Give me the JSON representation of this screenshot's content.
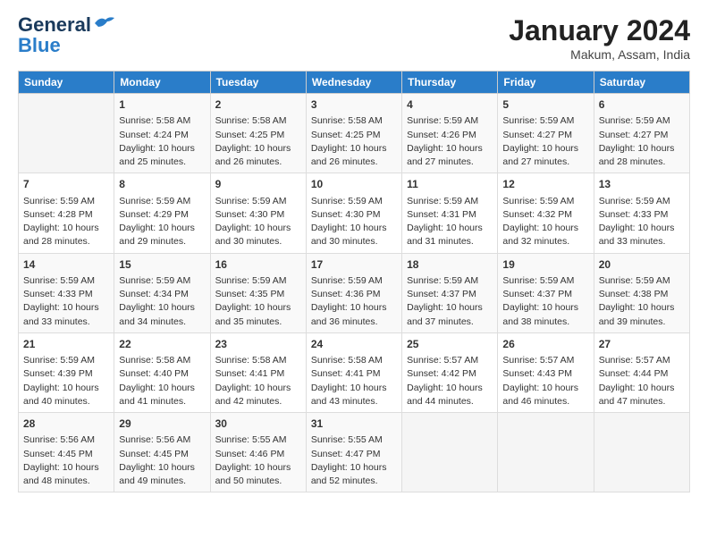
{
  "logo": {
    "line1": "General",
    "line2": "Blue"
  },
  "title": "January 2024",
  "location": "Makum, Assam, India",
  "headers": [
    "Sunday",
    "Monday",
    "Tuesday",
    "Wednesday",
    "Thursday",
    "Friday",
    "Saturday"
  ],
  "rows": [
    [
      {
        "day": "",
        "lines": []
      },
      {
        "day": "1",
        "lines": [
          "Sunrise: 5:58 AM",
          "Sunset: 4:24 PM",
          "Daylight: 10 hours",
          "and 25 minutes."
        ]
      },
      {
        "day": "2",
        "lines": [
          "Sunrise: 5:58 AM",
          "Sunset: 4:25 PM",
          "Daylight: 10 hours",
          "and 26 minutes."
        ]
      },
      {
        "day": "3",
        "lines": [
          "Sunrise: 5:58 AM",
          "Sunset: 4:25 PM",
          "Daylight: 10 hours",
          "and 26 minutes."
        ]
      },
      {
        "day": "4",
        "lines": [
          "Sunrise: 5:59 AM",
          "Sunset: 4:26 PM",
          "Daylight: 10 hours",
          "and 27 minutes."
        ]
      },
      {
        "day": "5",
        "lines": [
          "Sunrise: 5:59 AM",
          "Sunset: 4:27 PM",
          "Daylight: 10 hours",
          "and 27 minutes."
        ]
      },
      {
        "day": "6",
        "lines": [
          "Sunrise: 5:59 AM",
          "Sunset: 4:27 PM",
          "Daylight: 10 hours",
          "and 28 minutes."
        ]
      }
    ],
    [
      {
        "day": "7",
        "lines": [
          "Sunrise: 5:59 AM",
          "Sunset: 4:28 PM",
          "Daylight: 10 hours",
          "and 28 minutes."
        ]
      },
      {
        "day": "8",
        "lines": [
          "Sunrise: 5:59 AM",
          "Sunset: 4:29 PM",
          "Daylight: 10 hours",
          "and 29 minutes."
        ]
      },
      {
        "day": "9",
        "lines": [
          "Sunrise: 5:59 AM",
          "Sunset: 4:30 PM",
          "Daylight: 10 hours",
          "and 30 minutes."
        ]
      },
      {
        "day": "10",
        "lines": [
          "Sunrise: 5:59 AM",
          "Sunset: 4:30 PM",
          "Daylight: 10 hours",
          "and 30 minutes."
        ]
      },
      {
        "day": "11",
        "lines": [
          "Sunrise: 5:59 AM",
          "Sunset: 4:31 PM",
          "Daylight: 10 hours",
          "and 31 minutes."
        ]
      },
      {
        "day": "12",
        "lines": [
          "Sunrise: 5:59 AM",
          "Sunset: 4:32 PM",
          "Daylight: 10 hours",
          "and 32 minutes."
        ]
      },
      {
        "day": "13",
        "lines": [
          "Sunrise: 5:59 AM",
          "Sunset: 4:33 PM",
          "Daylight: 10 hours",
          "and 33 minutes."
        ]
      }
    ],
    [
      {
        "day": "14",
        "lines": [
          "Sunrise: 5:59 AM",
          "Sunset: 4:33 PM",
          "Daylight: 10 hours",
          "and 33 minutes."
        ]
      },
      {
        "day": "15",
        "lines": [
          "Sunrise: 5:59 AM",
          "Sunset: 4:34 PM",
          "Daylight: 10 hours",
          "and 34 minutes."
        ]
      },
      {
        "day": "16",
        "lines": [
          "Sunrise: 5:59 AM",
          "Sunset: 4:35 PM",
          "Daylight: 10 hours",
          "and 35 minutes."
        ]
      },
      {
        "day": "17",
        "lines": [
          "Sunrise: 5:59 AM",
          "Sunset: 4:36 PM",
          "Daylight: 10 hours",
          "and 36 minutes."
        ]
      },
      {
        "day": "18",
        "lines": [
          "Sunrise: 5:59 AM",
          "Sunset: 4:37 PM",
          "Daylight: 10 hours",
          "and 37 minutes."
        ]
      },
      {
        "day": "19",
        "lines": [
          "Sunrise: 5:59 AM",
          "Sunset: 4:37 PM",
          "Daylight: 10 hours",
          "and 38 minutes."
        ]
      },
      {
        "day": "20",
        "lines": [
          "Sunrise: 5:59 AM",
          "Sunset: 4:38 PM",
          "Daylight: 10 hours",
          "and 39 minutes."
        ]
      }
    ],
    [
      {
        "day": "21",
        "lines": [
          "Sunrise: 5:59 AM",
          "Sunset: 4:39 PM",
          "Daylight: 10 hours",
          "and 40 minutes."
        ]
      },
      {
        "day": "22",
        "lines": [
          "Sunrise: 5:58 AM",
          "Sunset: 4:40 PM",
          "Daylight: 10 hours",
          "and 41 minutes."
        ]
      },
      {
        "day": "23",
        "lines": [
          "Sunrise: 5:58 AM",
          "Sunset: 4:41 PM",
          "Daylight: 10 hours",
          "and 42 minutes."
        ]
      },
      {
        "day": "24",
        "lines": [
          "Sunrise: 5:58 AM",
          "Sunset: 4:41 PM",
          "Daylight: 10 hours",
          "and 43 minutes."
        ]
      },
      {
        "day": "25",
        "lines": [
          "Sunrise: 5:57 AM",
          "Sunset: 4:42 PM",
          "Daylight: 10 hours",
          "and 44 minutes."
        ]
      },
      {
        "day": "26",
        "lines": [
          "Sunrise: 5:57 AM",
          "Sunset: 4:43 PM",
          "Daylight: 10 hours",
          "and 46 minutes."
        ]
      },
      {
        "day": "27",
        "lines": [
          "Sunrise: 5:57 AM",
          "Sunset: 4:44 PM",
          "Daylight: 10 hours",
          "and 47 minutes."
        ]
      }
    ],
    [
      {
        "day": "28",
        "lines": [
          "Sunrise: 5:56 AM",
          "Sunset: 4:45 PM",
          "Daylight: 10 hours",
          "and 48 minutes."
        ]
      },
      {
        "day": "29",
        "lines": [
          "Sunrise: 5:56 AM",
          "Sunset: 4:45 PM",
          "Daylight: 10 hours",
          "and 49 minutes."
        ]
      },
      {
        "day": "30",
        "lines": [
          "Sunrise: 5:55 AM",
          "Sunset: 4:46 PM",
          "Daylight: 10 hours",
          "and 50 minutes."
        ]
      },
      {
        "day": "31",
        "lines": [
          "Sunrise: 5:55 AM",
          "Sunset: 4:47 PM",
          "Daylight: 10 hours",
          "and 52 minutes."
        ]
      },
      {
        "day": "",
        "lines": []
      },
      {
        "day": "",
        "lines": []
      },
      {
        "day": "",
        "lines": []
      }
    ]
  ]
}
